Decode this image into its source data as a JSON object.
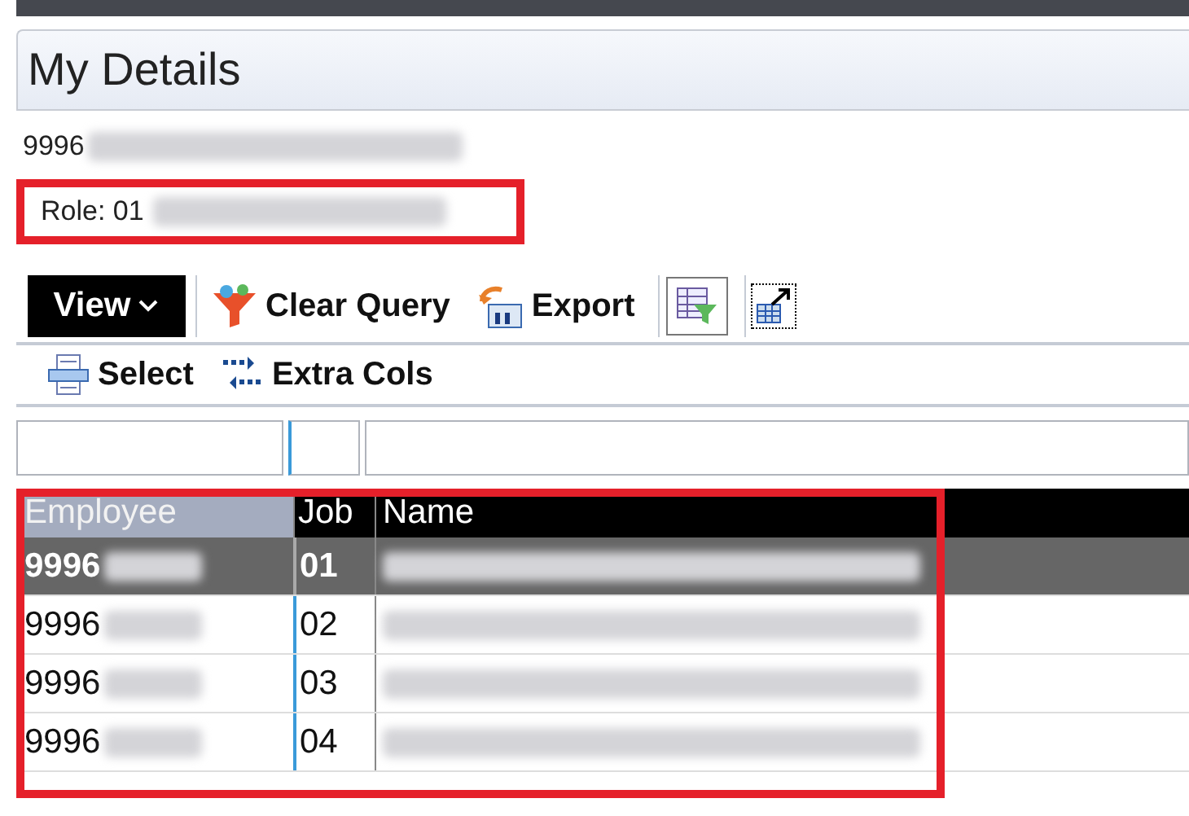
{
  "page": {
    "title": "My Details"
  },
  "details": {
    "employee_id": "9996",
    "role": "Role: 01"
  },
  "toolbar": [
    {
      "kind": "menu",
      "label": "View"
    },
    {
      "kind": "clear",
      "label": "Clear Query"
    },
    {
      "kind": "export",
      "label": "Export"
    },
    {
      "kind": "filter"
    },
    {
      "kind": "chart"
    }
  ],
  "toolbar2": [
    {
      "kind": "select",
      "label": "Select"
    },
    {
      "kind": "cols",
      "label": "Extra Cols"
    }
  ],
  "table": {
    "columns": [
      "Employee",
      "Job",
      "Name"
    ],
    "rows": [
      {
        "employee": "9996",
        "job": "01",
        "selected": true
      },
      {
        "employee": "9996",
        "job": "02",
        "selected": false
      },
      {
        "employee": "9996",
        "job": "03",
        "selected": false
      },
      {
        "employee": "9996",
        "job": "04",
        "selected": false
      }
    ]
  }
}
